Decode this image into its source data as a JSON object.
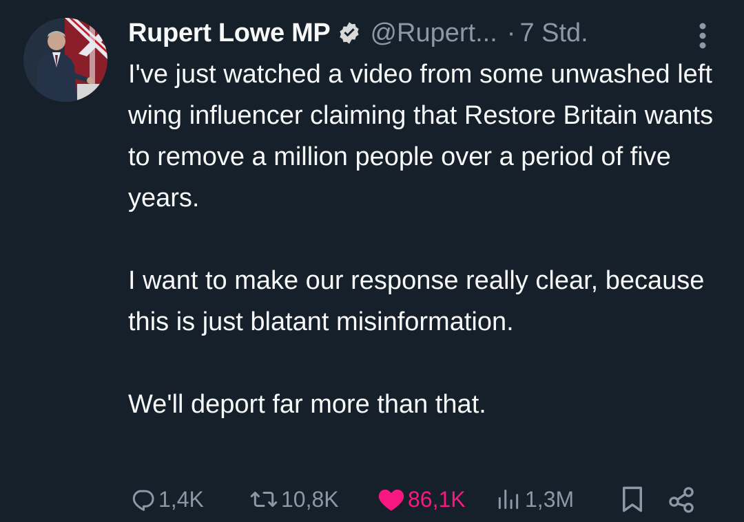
{
  "tweet": {
    "author": {
      "display_name": "Rupert Lowe MP",
      "handle": "@Rupert...",
      "verified": true,
      "avatar": "avatar-photo"
    },
    "time_separator": "·",
    "timestamp": "7 Std.",
    "body": {
      "paragraph_1": "I've just watched a video from some unwashed left wing influencer claiming that Restore Britain wants to remove a million people over a period of five years.",
      "paragraph_2": "I want to make our response really clear, because this is just blatant misinformation.",
      "paragraph_3": "We'll deport far more than that."
    },
    "actions": {
      "replies": {
        "icon": "reply-icon",
        "count": "1,4K"
      },
      "retweets": {
        "icon": "retweet-icon",
        "count": "10,8K"
      },
      "likes": {
        "icon": "heart-icon",
        "count": "86,1K",
        "liked": true
      },
      "views": {
        "icon": "views-icon",
        "count": "1,3M"
      },
      "bookmark": {
        "icon": "bookmark-icon"
      },
      "share": {
        "icon": "share-icon"
      }
    }
  },
  "colors": {
    "background": "#15202b",
    "text_primary": "#f7f9f9",
    "text_secondary": "#8b98a5",
    "like_active": "#f91880",
    "verified_badge": "#d9d9d9"
  }
}
